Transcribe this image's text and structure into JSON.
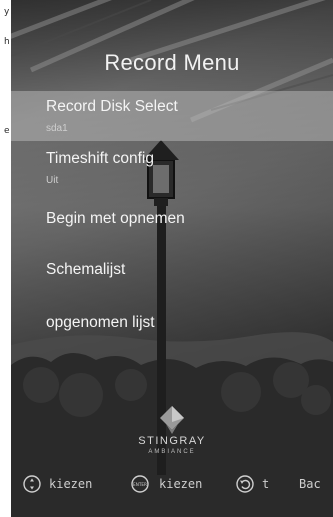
{
  "sidebar": {
    "cut_text": [
      "y",
      "h",
      "e"
    ]
  },
  "menu": {
    "title": "Record Menu",
    "items": [
      {
        "label": "Record Disk Select",
        "value": "sda1",
        "selected": true
      },
      {
        "label": "Timeshift config",
        "value": "Uit",
        "selected": false
      },
      {
        "label": "Begin met opnemen",
        "value": "",
        "selected": false
      },
      {
        "label": "Schemalijst",
        "value": "",
        "selected": false
      },
      {
        "label": "opgenomen lijst",
        "value": "",
        "selected": false
      }
    ]
  },
  "brand": {
    "name": "STINGRAY",
    "sub": "AMBIANCE"
  },
  "hints": [
    {
      "icon": "dpad-icon",
      "label": "kiezen"
    },
    {
      "icon": "enter-icon",
      "label": "kiezen",
      "badge": "ENTER"
    },
    {
      "icon": "back-icon",
      "label": "t"
    },
    {
      "icon": "",
      "label": "Bac"
    }
  ],
  "colors": {
    "selected_row": "#cdcdcd",
    "text": "#f4f4f4"
  }
}
